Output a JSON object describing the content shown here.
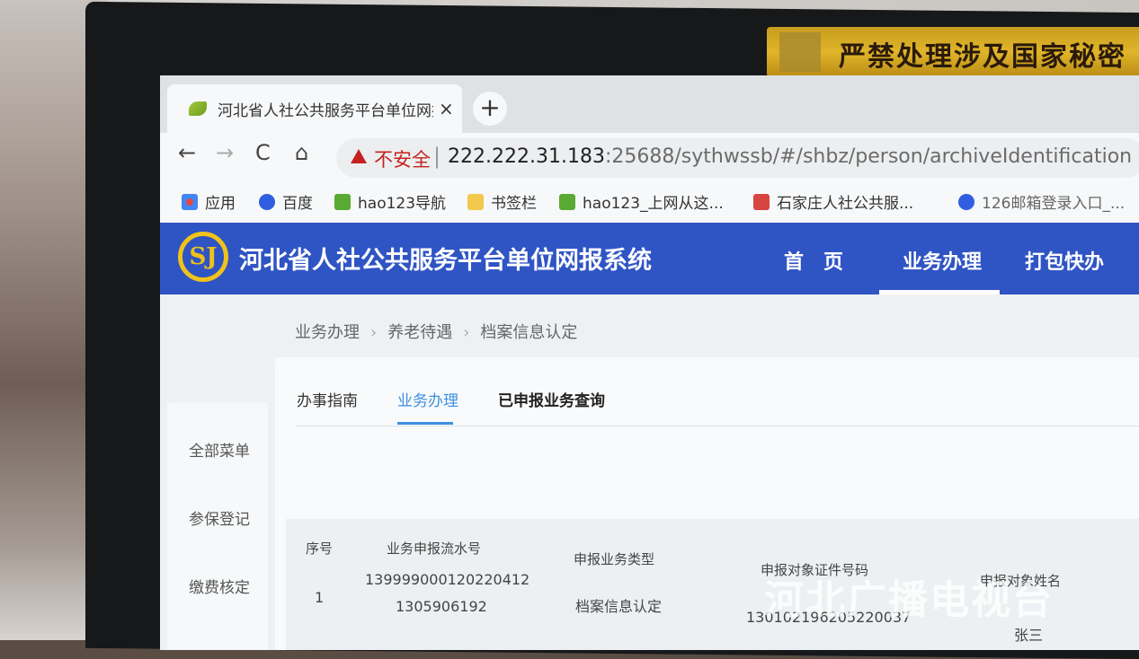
{
  "sticker": {
    "text": "严禁处理涉及国家秘密"
  },
  "browser": {
    "tab_title": "河北省人社公共服务平台单位网报",
    "tab_close": "×",
    "new_tab": "+",
    "nav": {
      "back": "←",
      "forward": "→",
      "reload": "C",
      "home": "⌂"
    },
    "security_label": "不安全",
    "url_host": "222.222.31.183",
    "url_rest": ":25688/sythwssb/#/shbz/person/archiveIdentification",
    "bookmarks": [
      {
        "label": "应用",
        "icon": "apps-grid-icon",
        "color": "#e8453c"
      },
      {
        "label": "百度",
        "icon": "baidu-paw-icon",
        "color": "#2f5fe0"
      },
      {
        "label": "hao123导航",
        "icon": "hao123-icon",
        "color": "#5aa932"
      },
      {
        "label": "书签栏",
        "icon": "folder-icon",
        "color": "#f2c94c"
      },
      {
        "label": "hao123_上网从这...",
        "icon": "hao123-icon",
        "color": "#5aa932"
      },
      {
        "label": "石家庄人社公共服...",
        "icon": "site-icon",
        "color": "#d64541"
      },
      {
        "label": "126邮箱登录入口_...",
        "icon": "baidu-paw-icon",
        "color": "#2f5fe0"
      }
    ]
  },
  "site": {
    "logo_text": "SJ",
    "title": "河北省人社公共服务平台单位网报系统",
    "nav": [
      "首　页",
      "业务办理",
      "打包快办"
    ]
  },
  "breadcrumb": [
    "业务办理",
    "养老待遇",
    "档案信息认定"
  ],
  "sidebar": [
    "全部菜单",
    "参保登记",
    "缴费核定"
  ],
  "panel_tabs": [
    "办事指南",
    "业务办理",
    "已申报业务查询"
  ],
  "table": {
    "headers": [
      "序号",
      "业务申报流水号",
      "申报业务类型",
      "申报对象证件号码",
      "申报对象姓名"
    ],
    "rows": [
      {
        "index": "1",
        "serial_a": "139999000120220412",
        "serial_b": "1305906192",
        "type": "档案信息认定",
        "id": "130102196205220037",
        "name": "张三"
      }
    ]
  },
  "watermark": "河北广播电视台"
}
